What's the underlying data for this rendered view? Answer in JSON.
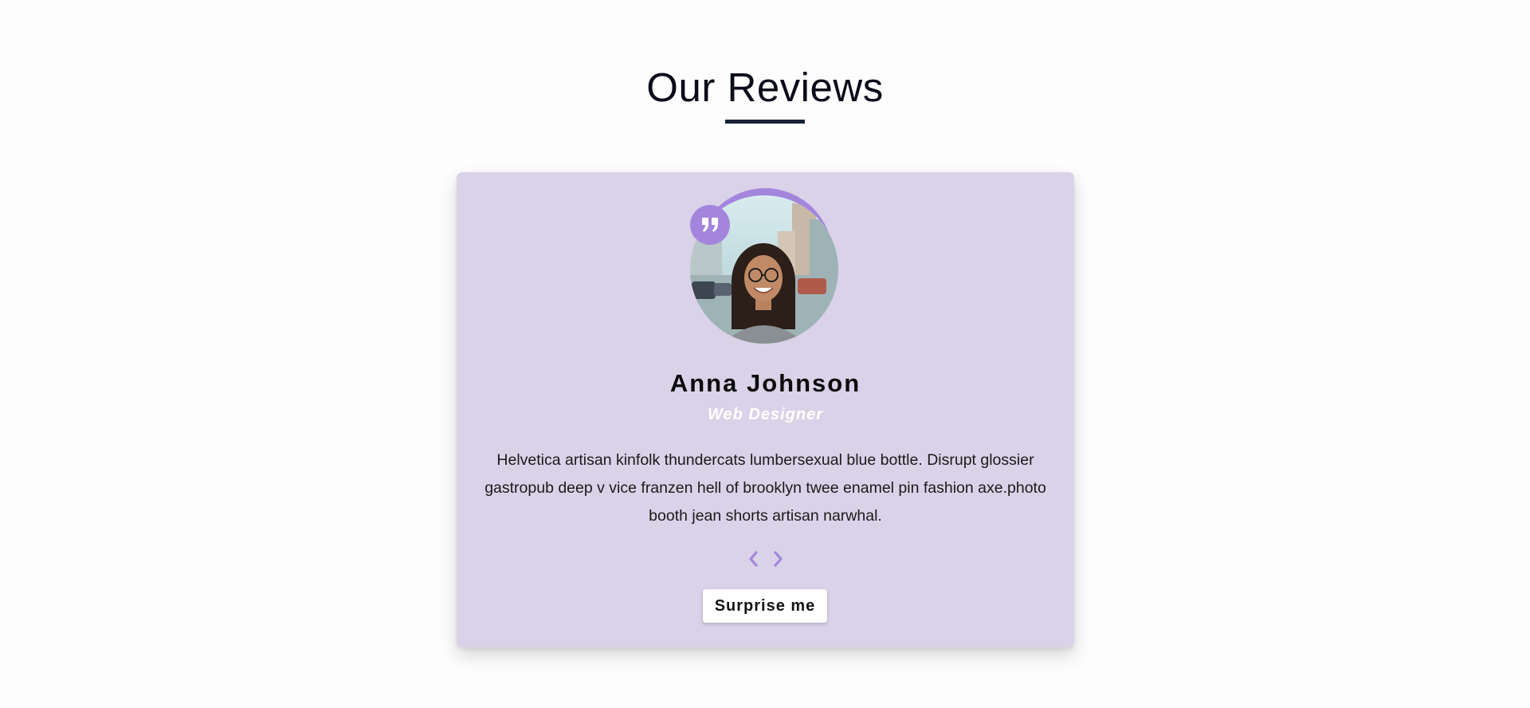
{
  "page": {
    "title": "Our Reviews"
  },
  "review": {
    "name": "Anna Johnson",
    "job": "Web Designer",
    "text": "Helvetica artisan kinfolk thundercats lumbersexual blue bottle. Disrupt glossier gastropub deep v vice franzen hell of brooklyn twee enamel pin fashion axe.photo booth jean shorts artisan narwhal.",
    "photo_alt": "reviewer photo"
  },
  "controls": {
    "prev_icon": "chevron-left-icon",
    "next_icon": "chevron-right-icon",
    "quote_icon": "quote-right-icon",
    "surprise_label": "Surprise me"
  },
  "colors": {
    "accent": "#a485dd",
    "card_background": "#d9d2e8",
    "underline": "#1a2238",
    "role_text": "#ffffff"
  }
}
